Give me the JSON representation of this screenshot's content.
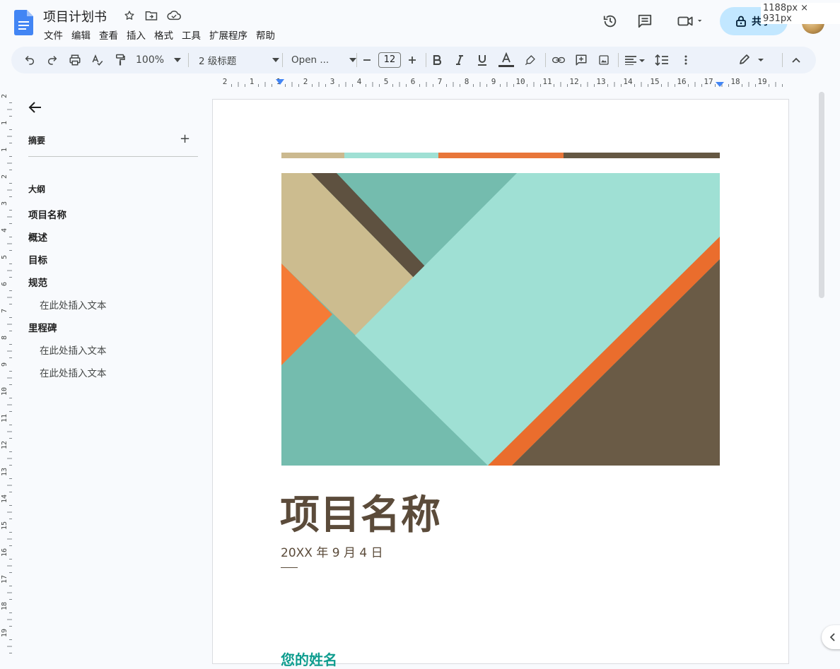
{
  "doc": {
    "title": "项目计划书"
  },
  "menu": [
    "文件",
    "编辑",
    "查看",
    "插入",
    "格式",
    "工具",
    "扩展程序",
    "帮助"
  ],
  "share": {
    "label": "共享"
  },
  "screenshot_size_label": "1188px × 931px",
  "toolbar": {
    "zoom": "100%",
    "style": "2 级标题",
    "font": "Open ...",
    "font_size": "12"
  },
  "ruler": {
    "labels": [
      "2",
      "1",
      "1",
      "2",
      "3",
      "4",
      "5",
      "6",
      "7",
      "8",
      "9",
      "10",
      "11",
      "12",
      "13",
      "14",
      "15",
      "16",
      "17",
      "18",
      "19"
    ],
    "left_labels": [
      "2",
      "1",
      "1",
      "2",
      "3",
      "4",
      "5",
      "6",
      "7",
      "8",
      "9",
      "10",
      "11",
      "12",
      "13",
      "14",
      "15",
      "16",
      "17",
      "18",
      "19"
    ]
  },
  "sidebar": {
    "summary_label": "摘要",
    "outline_label": "大纲",
    "outline": [
      {
        "text": "项目名称",
        "level": 1
      },
      {
        "text": "概述",
        "level": 1
      },
      {
        "text": "目标",
        "level": 1
      },
      {
        "text": "规范",
        "level": 1
      },
      {
        "text": "在此处插入文本",
        "level": 2
      },
      {
        "text": "里程碑",
        "level": 1
      },
      {
        "text": "在此处插入文本",
        "level": 2
      },
      {
        "text": "在此处插入文本",
        "level": 2
      }
    ]
  },
  "page": {
    "title": "项目名称",
    "date": "20XX 年 9 月 4 日",
    "author": "您的姓名"
  },
  "colors": {
    "accent_tan": "#cbb98f",
    "accent_teal_light": "#9fe0d4",
    "accent_orange": "#e8763a",
    "accent_brown": "#655843",
    "title_brown": "#5b4b3a",
    "author_teal": "#0f9d8f",
    "share_bg": "#c2e7ff"
  }
}
